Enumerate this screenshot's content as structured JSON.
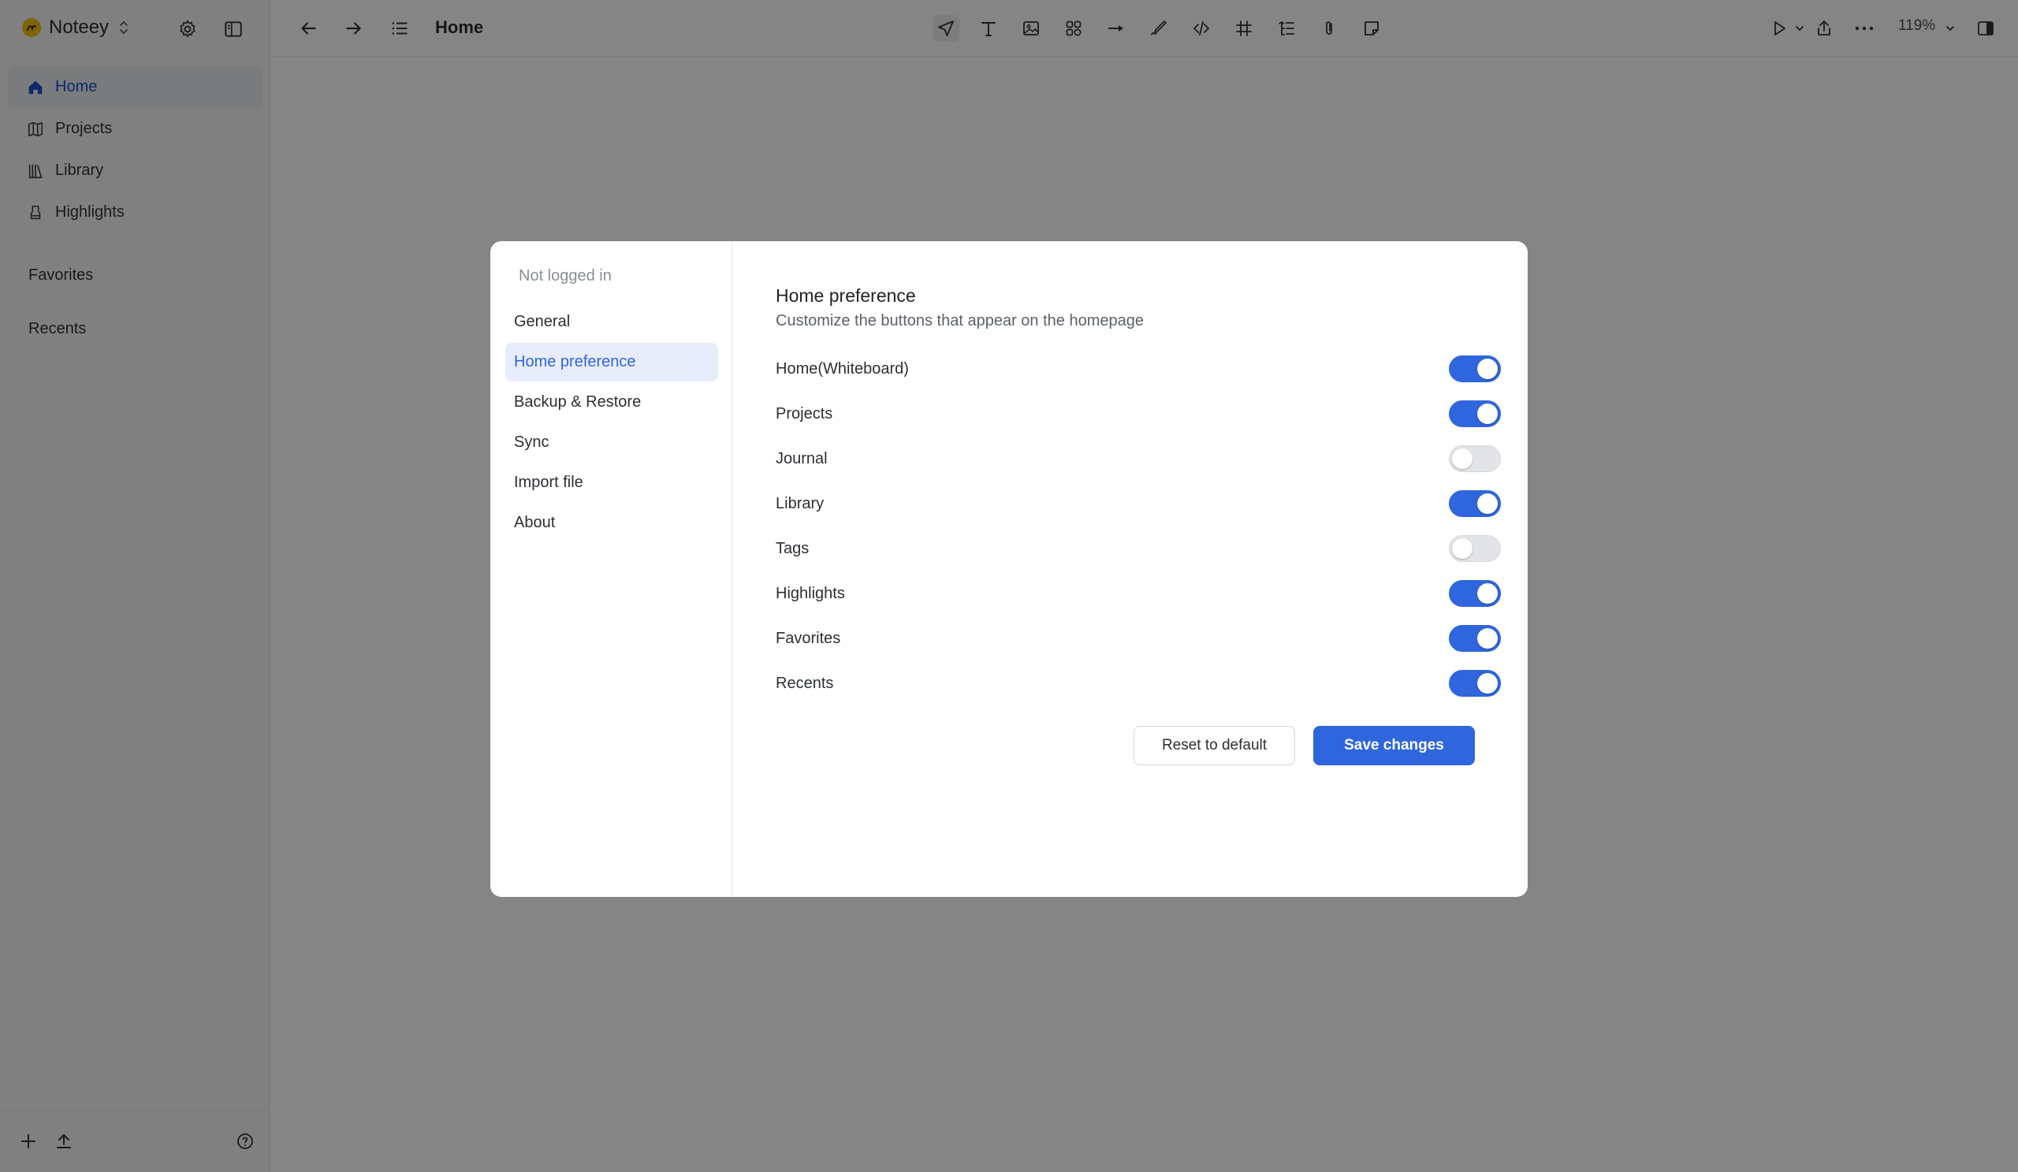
{
  "app": {
    "name": "Noteey",
    "page_title": "Home",
    "zoom": "119%"
  },
  "sidebar": {
    "items": [
      {
        "label": "Home",
        "icon": "home-icon",
        "active": true
      },
      {
        "label": "Projects",
        "icon": "map-icon",
        "active": false
      },
      {
        "label": "Library",
        "icon": "library-icon",
        "active": false
      },
      {
        "label": "Highlights",
        "icon": "highlighter-icon",
        "active": false
      }
    ],
    "sections": {
      "favorites": "Favorites",
      "recents": "Recents"
    }
  },
  "toolbar": {
    "tools": [
      "select-pointer-icon",
      "text-icon",
      "image-icon",
      "shapes-icon",
      "arrow-icon",
      "pen-icon",
      "code-icon",
      "frame-icon",
      "outline-icon",
      "attachment-icon",
      "sticky-note-icon"
    ]
  },
  "modal": {
    "account": "Not logged in",
    "nav": [
      {
        "label": "General",
        "active": false
      },
      {
        "label": "Home preference",
        "active": true
      },
      {
        "label": "Backup & Restore",
        "active": false
      },
      {
        "label": "Sync",
        "active": false
      },
      {
        "label": "Import file",
        "active": false
      },
      {
        "label": "About",
        "active": false
      }
    ],
    "title": "Home preference",
    "subtitle": "Customize the buttons that appear on the homepage",
    "preferences": [
      {
        "label": "Home(Whiteboard)",
        "enabled": true
      },
      {
        "label": "Projects",
        "enabled": true
      },
      {
        "label": "Journal",
        "enabled": false
      },
      {
        "label": "Library",
        "enabled": true
      },
      {
        "label": "Tags",
        "enabled": false
      },
      {
        "label": "Highlights",
        "enabled": true
      },
      {
        "label": "Favorites",
        "enabled": true
      },
      {
        "label": "Recents",
        "enabled": true
      }
    ],
    "reset_label": "Reset to default",
    "save_label": "Save changes"
  },
  "colors": {
    "accent": "#2f66dd",
    "overlay": "rgba(0,0,0,0.48)",
    "sidebar_bg": "#f6f6f7"
  }
}
